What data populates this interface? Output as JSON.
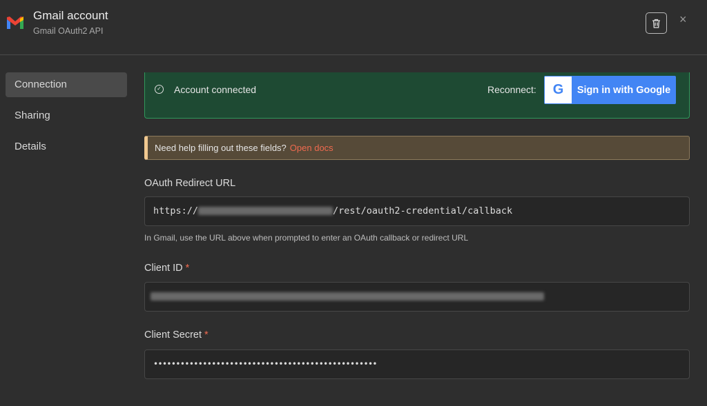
{
  "header": {
    "title": "Gmail account",
    "subtitle": "Gmail OAuth2 API",
    "close": "×"
  },
  "sidebar": {
    "items": [
      {
        "label": "Connection"
      },
      {
        "label": "Sharing"
      },
      {
        "label": "Details"
      }
    ]
  },
  "status": {
    "text": "Account connected",
    "reconnect_label": "Reconnect:",
    "google_button": "Sign in with Google"
  },
  "help": {
    "text": "Need help filling out these fields?",
    "link": "Open docs"
  },
  "fields": {
    "redirect": {
      "label": "OAuth Redirect URL",
      "prefix": "https://",
      "suffix": "/rest/oauth2-credential/callback",
      "hint": "In Gmail, use the URL above when prompted to enter an OAuth callback or redirect URL"
    },
    "client_id": {
      "label": "Client ID",
      "required": "*"
    },
    "client_secret": {
      "label": "Client Secret",
      "required": "*",
      "value": "••••••••••••••••••••••••••••••••••••••••••••••••••"
    }
  }
}
